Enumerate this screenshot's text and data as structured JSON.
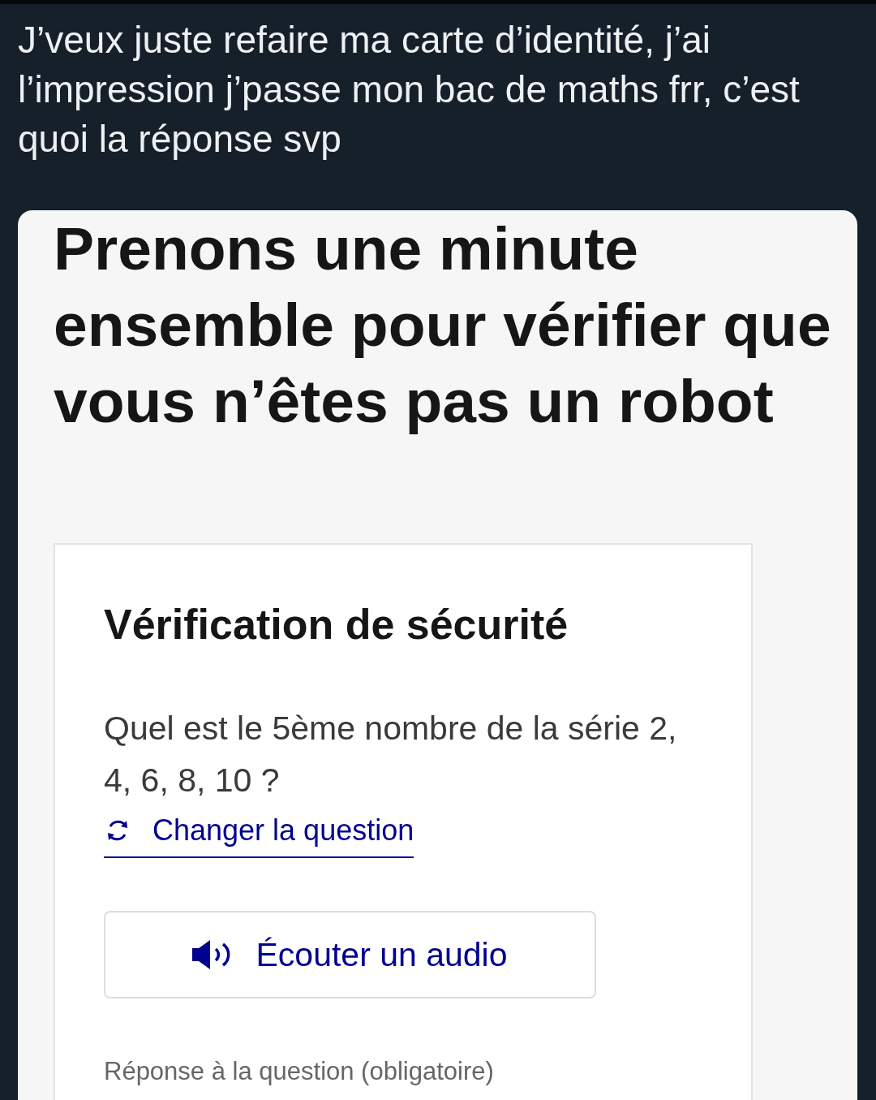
{
  "post": {
    "text": "J’veux juste refaire ma carte d’identité, j’ai l’impression j’passe mon bac de maths frr, c’est quoi la réponse svp"
  },
  "captcha": {
    "title": "Prenons une minute ensemble pour vérifier que vous n’êtes pas un robot",
    "panel": {
      "heading": "Vérification de sécurité",
      "question": "Quel est le 5ème nombre de la série 2, 4, 6, 8, 10 ?",
      "change_link": "Changer la question",
      "audio_button": "Écouter un audio",
      "answer_label": "Réponse à la question (obligatoire)"
    }
  }
}
